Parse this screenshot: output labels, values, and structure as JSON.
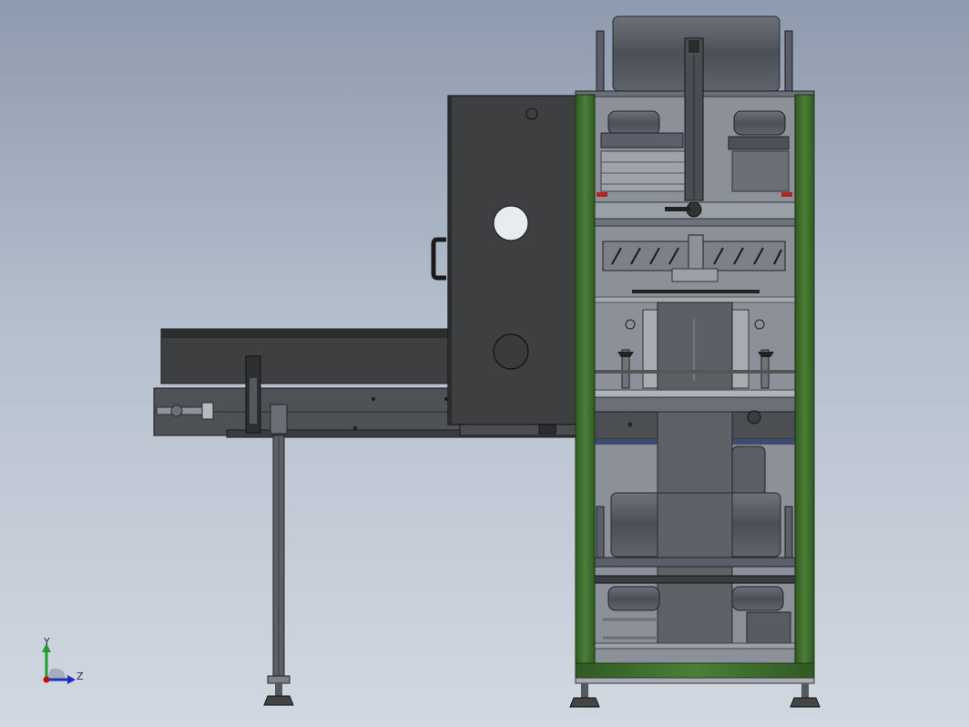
{
  "app": {
    "type": "cad-viewport",
    "view": "side"
  },
  "triad": {
    "y_label": "Y",
    "z_label": "Z",
    "colors": {
      "y": "#1f9e2e",
      "z": "#1c2fbf",
      "origin": "#c01010",
      "x_shade": "#9aa3b8"
    }
  },
  "colors": {
    "background_top": "#8e9aae",
    "background_bottom": "#d2d8e1",
    "frame_green": "#3c6b2c",
    "panel_dark": "#3d3f41",
    "panel_mid": "#505357",
    "roller": "#5a5e66",
    "steel_light": "#a9adb3"
  }
}
